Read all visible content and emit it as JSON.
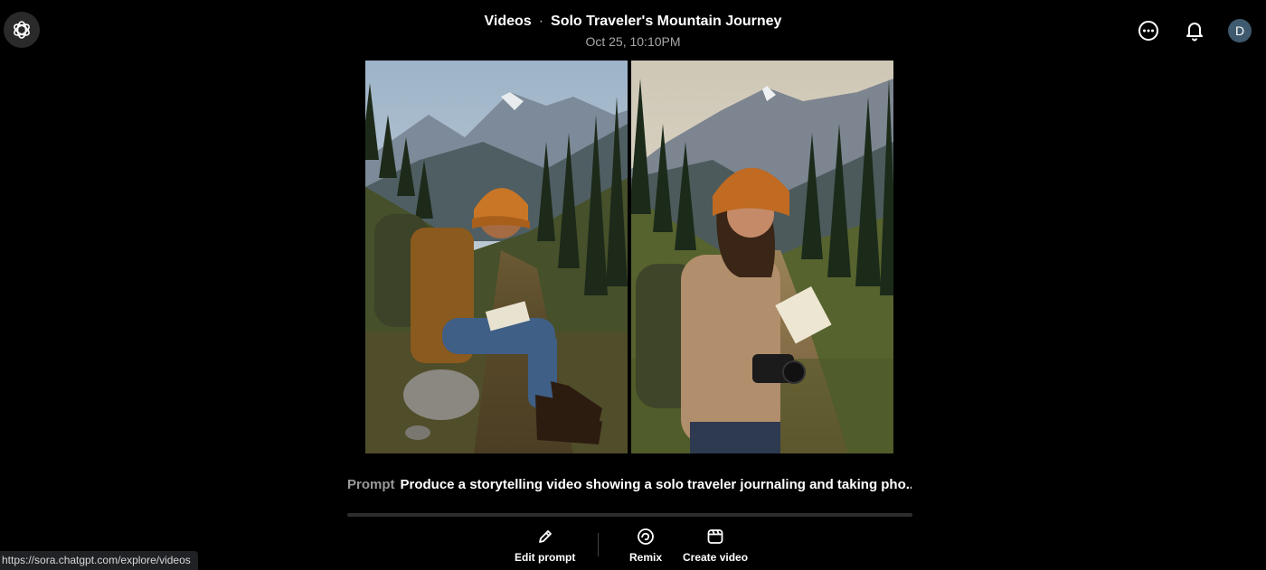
{
  "header": {
    "section": "Videos",
    "separator": "·",
    "title": "Solo Traveler's Mountain Journey",
    "date": "Oct 25, 10:10PM"
  },
  "user": {
    "avatar_initial": "D"
  },
  "prompt": {
    "label": "Prompt",
    "text": "Produce a storytelling video showing a solo traveler journaling and taking pho..."
  },
  "actions": {
    "edit_prompt": "Edit prompt",
    "remix": "Remix",
    "create_video": "Create video"
  },
  "status_bar": {
    "url": "https://sora.chatgpt.com/explore/videos"
  },
  "colors": {
    "background": "#000000",
    "avatar": "#3f5a6e",
    "muted_text": "#a8a8a8"
  },
  "icons": [
    "openai-logo-icon",
    "more-options-icon",
    "bell-icon",
    "pencil-icon",
    "remix-icon",
    "clapperboard-icon"
  ]
}
